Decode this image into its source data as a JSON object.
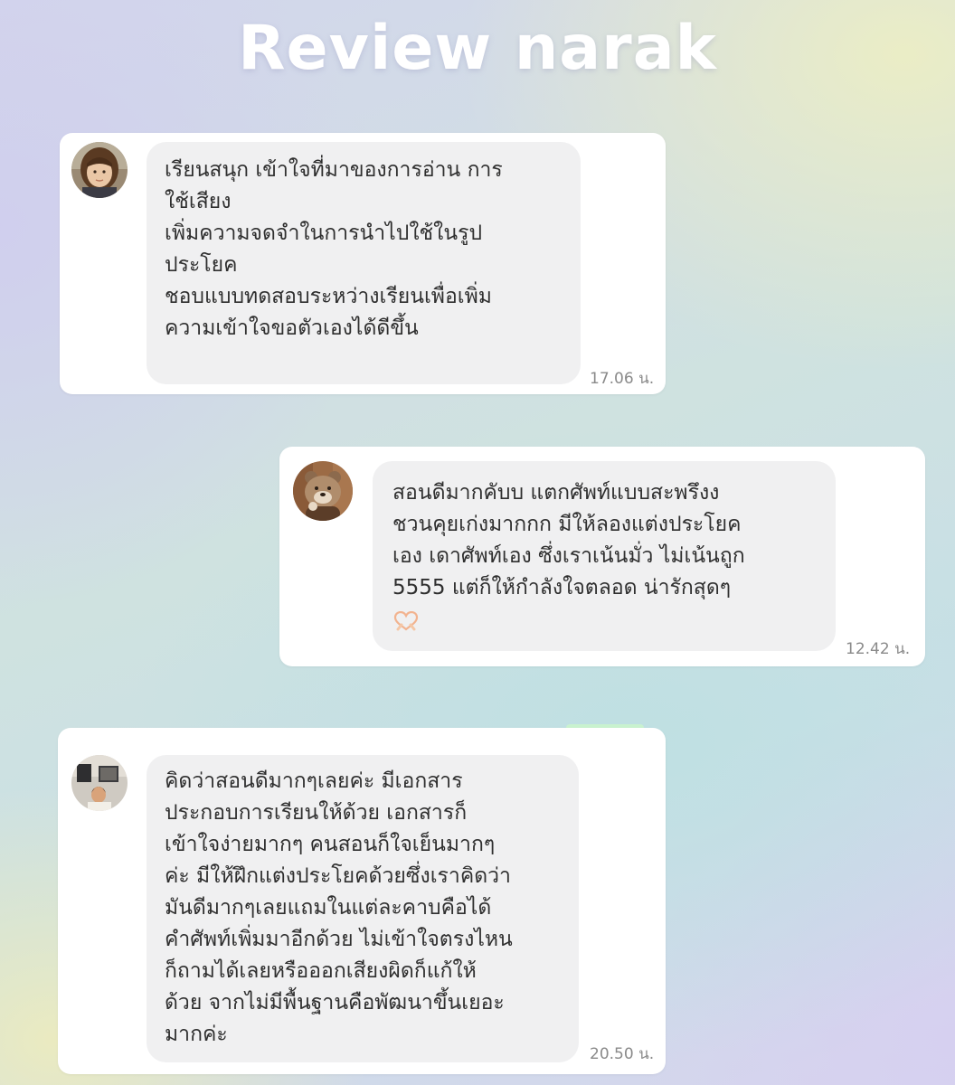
{
  "page": {
    "title": "Review narak"
  },
  "reviews": [
    {
      "lines": [
        "เรียนสนุก เข้าใจที่มาของการอ่าน การ",
        "ใช้เสียง",
        "เพิ่มความจดจำในการนำไปใช้ในรูป",
        "ประโยค",
        "ชอบแบบทดสอบระหว่างเรียนเพื่อเพิ่ม",
        "ความเข้าใจขอตัวเองได้ดีขึ้น"
      ],
      "time": "17.06 น.",
      "avatar_icon": "child-photo-avatar"
    },
    {
      "lines": [
        "สอนดีมากคับบ แตกศัพท์แบบสะพรึงง",
        "ชวนคุยเก่งมากกก มีให้ลองแต่งประโยค",
        "เอง เดาศัพท์เอง ซึ่งเราเน้นมั่ว ไม่เน้นถูก",
        "5555 แต่ก็ให้กำลังใจตลอด น่ารักสุดๆ"
      ],
      "emoji_icon": "heart-hands-emoji",
      "time": "12.42 น.",
      "avatar_icon": "bear-avatar"
    },
    {
      "lines": [
        "คิดว่าสอนดีมากๆเลยค่ะ มีเอกสาร",
        "ประกอบการเรียนให้ด้วย เอกสารก็",
        "เข้าใจง่ายมากๆ คนสอนก็ใจเย็นมากๆ",
        "ค่ะ มีให้ฝึกแต่งประโยคด้วยซึ่งเราคิดว่า",
        "มันดีมากๆเลยแถมในแต่ละคาบคือได้",
        "คำศัพท์เพิ่มมาอีกด้วย ไม่เข้าใจตรงไหน",
        "ก็ถามได้เลยหรือออกเสียงผิดก็แก้ให้",
        "ด้วย จากไม่มีพื้นฐานคือพัฒนาขึ้นเยอะ",
        "มากค่ะ"
      ],
      "time": "20.50 น.",
      "avatar_icon": "person-photo-avatar"
    }
  ]
}
